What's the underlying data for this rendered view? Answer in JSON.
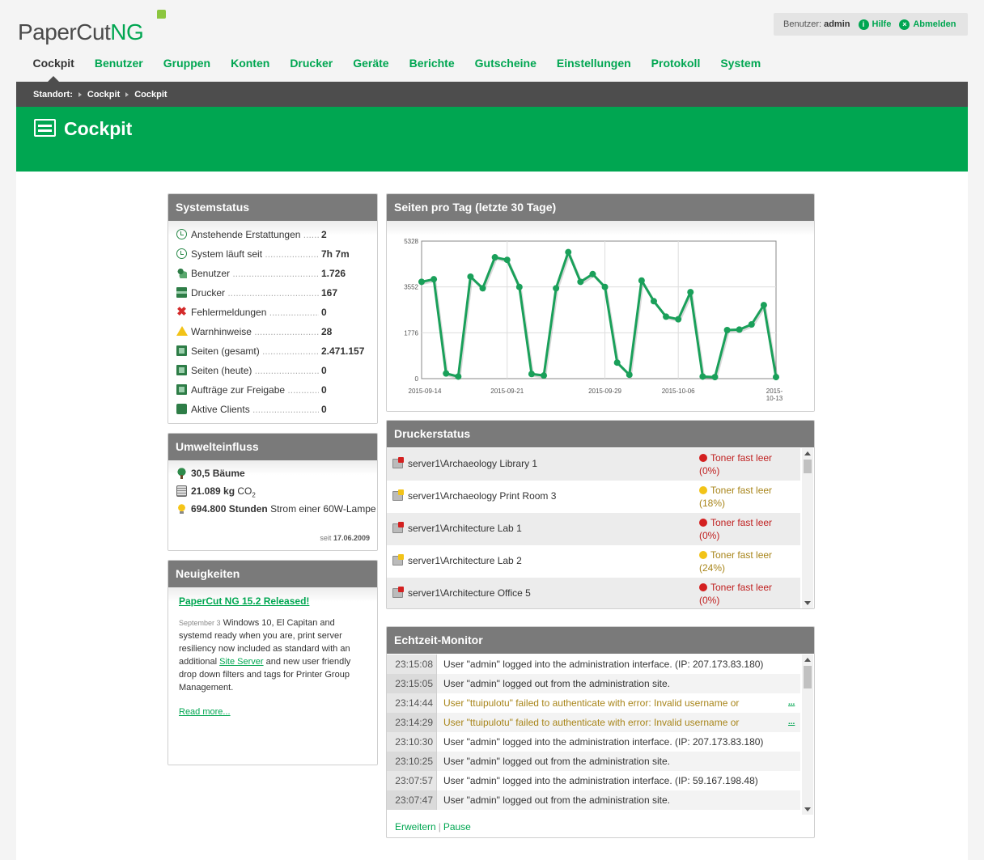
{
  "brand": {
    "name_part1": "PaperCut",
    "name_part2": "NG"
  },
  "userbox": {
    "label": "Benutzer:",
    "username": "admin",
    "help": "Hilfe",
    "logout": "Abmelden"
  },
  "nav": [
    "Cockpit",
    "Benutzer",
    "Gruppen",
    "Konten",
    "Drucker",
    "Geräte",
    "Berichte",
    "Gutscheine",
    "Einstellungen",
    "Protokoll",
    "System"
  ],
  "breadcrumb": {
    "label": "Standort:",
    "items": [
      "Cockpit",
      "Cockpit"
    ]
  },
  "page_title": "Cockpit",
  "system_status": {
    "title": "Systemstatus",
    "rows": [
      {
        "icon": "clock-icon",
        "label": "Anstehende Erstattungen",
        "value": "2"
      },
      {
        "icon": "clock-icon",
        "label": "System läuft seit",
        "value": "7h 7m"
      },
      {
        "icon": "users-icon",
        "label": "Benutzer",
        "value": "1.726"
      },
      {
        "icon": "printer-icon",
        "label": "Drucker",
        "value": "167"
      },
      {
        "icon": "error-icon",
        "label": "Fehlermeldungen",
        "value": "0"
      },
      {
        "icon": "warning-icon",
        "label": "Warnhinweise",
        "value": "28"
      },
      {
        "icon": "pages-icon",
        "label": "Seiten (gesamt)",
        "value": "2.471.157"
      },
      {
        "icon": "pages-icon",
        "label": "Seiten (heute)",
        "value": "0"
      },
      {
        "icon": "pages-icon",
        "label": "Aufträge zur Freigabe",
        "value": "0"
      },
      {
        "icon": "client-icon",
        "label": "Aktive Clients",
        "value": "0"
      }
    ]
  },
  "environment": {
    "title": "Umwelteinfluss",
    "trees_value": "30,5 Bäume",
    "co2_value": "21.089 kg",
    "co2_unit": "CO",
    "co2_sub": "2",
    "hours_value": "694.800 Stunden",
    "hours_rest": "Strom einer 60W-Lampe",
    "since_label": "seit",
    "since_date": "17.06.2009"
  },
  "news": {
    "title": "Neuigkeiten",
    "headline": "PaperCut NG 15.2 Released!",
    "date": "September 3",
    "body_1": "Windows 10, El Capitan and systemd ready when you are, print server resiliency now included as standard with an additional",
    "body_link": "Site Server",
    "body_2": "and new user friendly drop down filters and tags for Printer Group Management.",
    "read_more": "Read more..."
  },
  "chart_panel_title": "Seiten pro Tag (letzte 30 Tage)",
  "chart_data": {
    "type": "line",
    "title": "",
    "xlabel": "",
    "ylabel": "",
    "ylim": [
      0,
      5328
    ],
    "yticks": [
      "0",
      "1776",
      "3552",
      "5328"
    ],
    "xtick_labels": [
      "2015-09-14",
      "2015-09-21",
      "2015-09-29",
      "2015-10-06",
      "2015-10-13"
    ],
    "grid": true,
    "series_color": "#1aa05a",
    "values": [
      3750,
      3850,
      200,
      80,
      3950,
      3500,
      4700,
      4600,
      3550,
      180,
      120,
      3500,
      4900,
      3750,
      4050,
      3550,
      620,
      150,
      3800,
      3000,
      2400,
      2300,
      3350,
      80,
      60,
      1880,
      1900,
      2100,
      2850,
      60
    ]
  },
  "printer_status": {
    "title": "Druckerstatus",
    "rows": [
      {
        "name": "server1\\Archaeology Library 1",
        "status": "Toner fast leer",
        "pct": "(0%)",
        "level": "red"
      },
      {
        "name": "server1\\Archaeology Print Room 3",
        "status": "Toner fast leer",
        "pct": "(18%)",
        "level": "yellow"
      },
      {
        "name": "server1\\Architecture Lab 1",
        "status": "Toner fast leer",
        "pct": "(0%)",
        "level": "red"
      },
      {
        "name": "server1\\Architecture Lab 2",
        "status": "Toner fast leer",
        "pct": "(24%)",
        "level": "yellow"
      },
      {
        "name": "server1\\Architecture Office 5",
        "status": "Toner fast leer",
        "pct": "(0%)",
        "level": "red"
      }
    ]
  },
  "monitor": {
    "title": "Echtzeit-Monitor",
    "rows": [
      {
        "time": "23:15:08",
        "msg": "User \"admin\" logged into the administration interface. (IP: 207.173.83.180)",
        "warn": false
      },
      {
        "time": "23:15:05",
        "msg": "User \"admin\" logged out from the administration site.",
        "warn": false
      },
      {
        "time": "23:14:44",
        "msg": "User \"ttuipulotu\" failed to authenticate with error: Invalid username or",
        "warn": true
      },
      {
        "time": "23:14:29",
        "msg": "User \"ttuipulotu\" failed to authenticate with error: Invalid username or",
        "warn": true
      },
      {
        "time": "23:10:30",
        "msg": "User \"admin\" logged into the administration interface. (IP: 207.173.83.180)",
        "warn": false
      },
      {
        "time": "23:10:25",
        "msg": "User \"admin\" logged out from the administration site.",
        "warn": false
      },
      {
        "time": "23:07:57",
        "msg": "User \"admin\" logged into the administration interface. (IP: 59.167.198.48)",
        "warn": false
      },
      {
        "time": "23:07:47",
        "msg": "User \"admin\" logged out from the administration site.",
        "warn": false
      }
    ],
    "more_label": "...",
    "expand": "Erweitern",
    "pause": "Pause"
  },
  "colors": {
    "brand_green": "#00a651",
    "status_red": "#d42020",
    "status_yellow": "#f2c318",
    "warn_text": "#a8851a"
  }
}
